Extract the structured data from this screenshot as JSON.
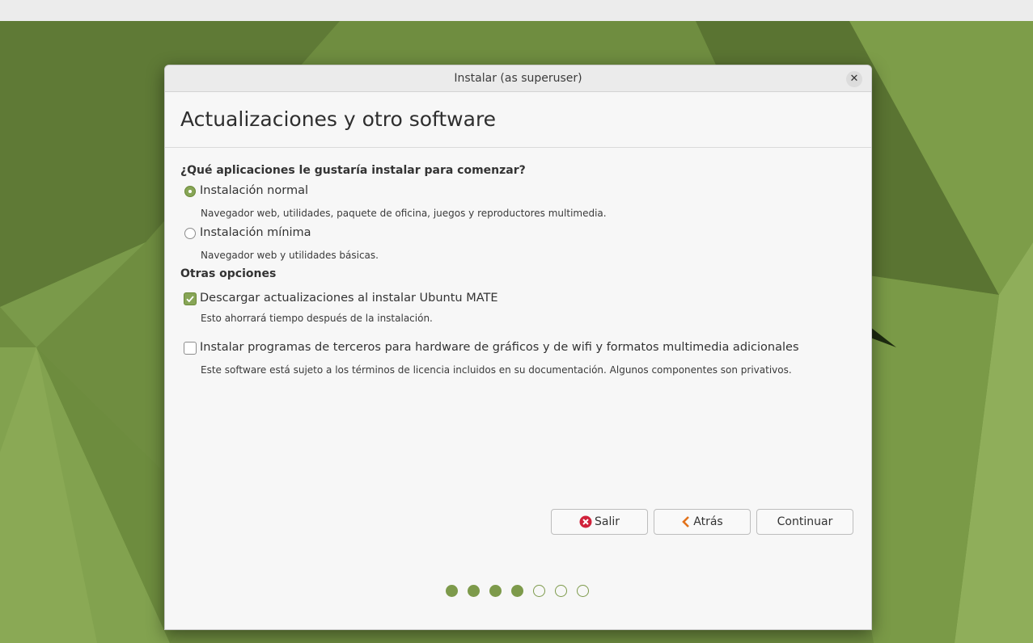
{
  "window": {
    "title": "Instalar (as superuser)",
    "close_icon": "close-icon"
  },
  "page": {
    "heading": "Actualizaciones y otro software"
  },
  "apps": {
    "question": "¿Qué aplicaciones le gustaría instalar para comenzar?",
    "options": [
      {
        "label": "Instalación normal",
        "description": "Navegador web, utilidades, paquete de oficina, juegos y reproductores multimedia.",
        "selected": true
      },
      {
        "label": "Instalación mínima",
        "description": "Navegador web y utilidades básicas.",
        "selected": false
      }
    ]
  },
  "other": {
    "heading": "Otras opciones",
    "options": [
      {
        "label": "Descargar actualizaciones al instalar Ubuntu MATE",
        "description": "Esto ahorrará tiempo después de la instalación.",
        "checked": true
      },
      {
        "label": "Instalar programas de terceros para hardware de gráficos y de wifi y formatos multimedia adicionales",
        "description": "Este software está sujeto a los términos de licencia incluidos en su documentación. Algunos componentes son privativos.",
        "checked": false
      }
    ]
  },
  "buttons": {
    "quit": "Salir",
    "back": "Atrás",
    "continue": "Continuar"
  },
  "progress": {
    "current_step": 4,
    "total_steps": 7
  },
  "colors": {
    "accent": "#87a556",
    "quit_icon": "#d0213a",
    "back_icon": "#e2721b"
  }
}
